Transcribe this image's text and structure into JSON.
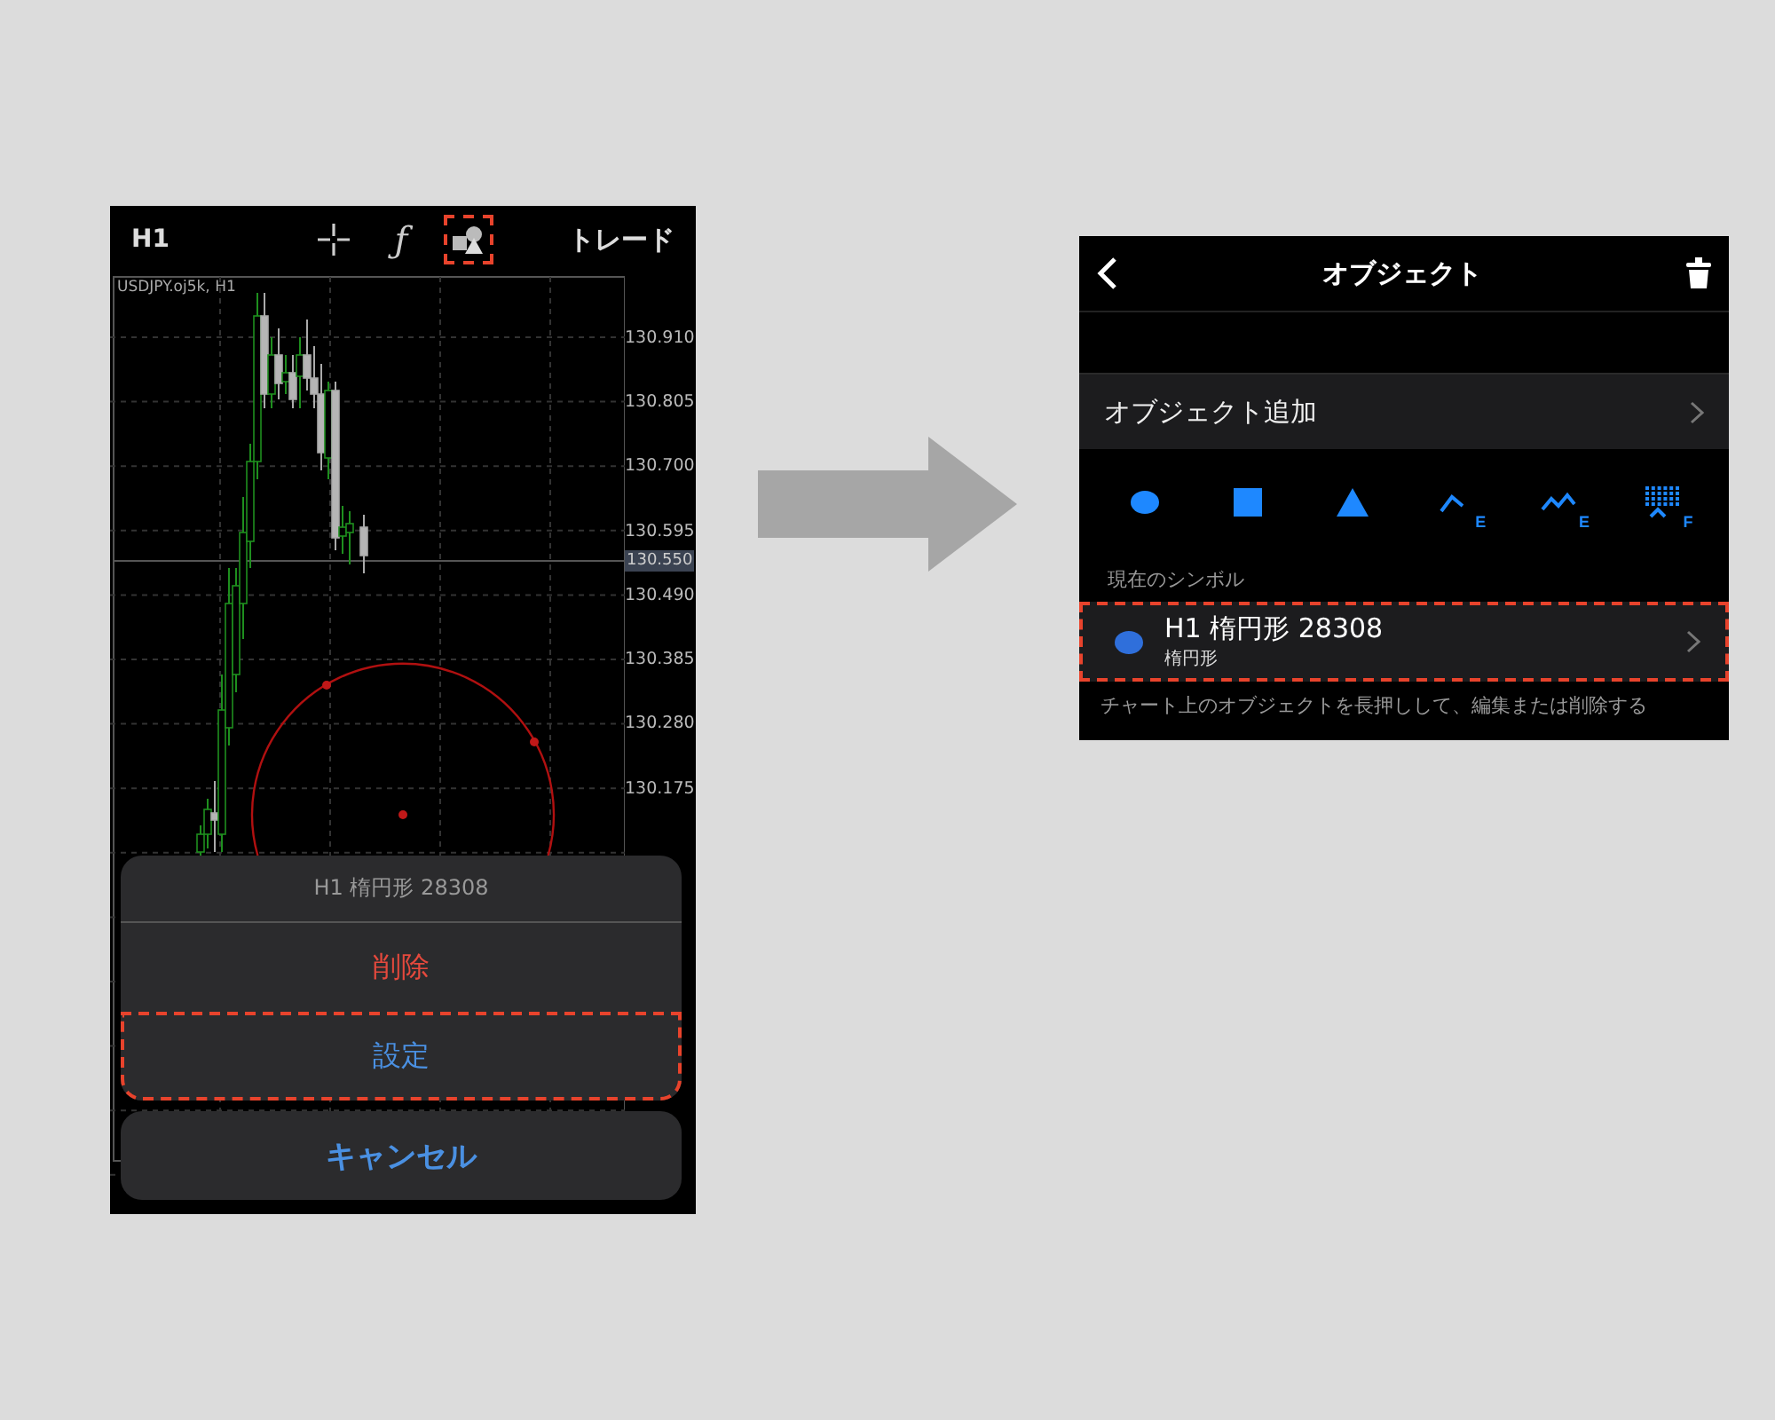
{
  "left_screen": {
    "toolbar": {
      "timeframe": "H1",
      "trade_label": "トレード",
      "tools": [
        {
          "kind": "crosshair",
          "highlighted": false
        },
        {
          "kind": "function",
          "label": "ƒ",
          "highlighted": false
        },
        {
          "kind": "objects",
          "highlighted": true
        }
      ]
    },
    "chart": {
      "symbol": "USDJPY.oj5k, H1",
      "price_labels": [
        {
          "kind": "tick",
          "text": "130.910"
        },
        {
          "kind": "tick",
          "text": "130.805"
        },
        {
          "kind": "tick",
          "text": "130.700"
        },
        {
          "kind": "tick",
          "text": "130.595"
        },
        {
          "kind": "current",
          "text": "130.550"
        },
        {
          "kind": "tick",
          "text": "130.490"
        },
        {
          "kind": "tick",
          "text": "130.385"
        },
        {
          "kind": "tick",
          "text": "130.280"
        },
        {
          "kind": "tick",
          "text": "130.175"
        }
      ]
    },
    "action_sheet": {
      "title": "H1 楕円形 28308",
      "actions": [
        {
          "label": "削除",
          "kind": "destructive",
          "highlighted": false
        },
        {
          "label": "設定",
          "kind": "default",
          "highlighted": true
        }
      ],
      "cancel": "キャンセル"
    }
  },
  "right_screen": {
    "title": "オブジェクト",
    "add_row": "オブジェクト追加",
    "tools": [
      {
        "kind": "ellipse"
      },
      {
        "kind": "rectangle"
      },
      {
        "kind": "triangle"
      },
      {
        "kind": "trendline",
        "badge": "E"
      },
      {
        "kind": "zigzag",
        "badge": "E"
      },
      {
        "kind": "grid",
        "badge": "F"
      }
    ],
    "section_header": "現在のシンボル",
    "objects": [
      {
        "title": "H1 楕円形 28308",
        "subtitle": "楕円形",
        "highlighted": true
      }
    ],
    "footer": "チャート上のオブジェクトを長押しして、編集または削除する"
  }
}
